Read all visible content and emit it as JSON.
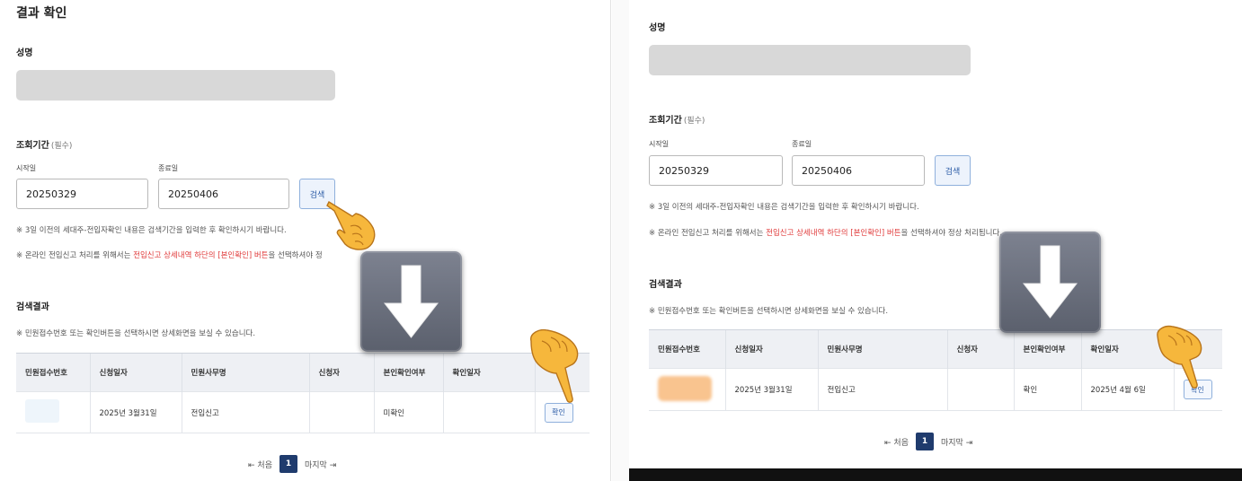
{
  "left": {
    "page_title": "결과 확인",
    "name_label": "성명",
    "period_label": "조회기간",
    "period_required": "(필수)",
    "start_label": "시작일",
    "end_label": "종료일",
    "start_value": "20250329",
    "end_value": "20250406",
    "search_label": "검색",
    "notice1": "※ 3일 이전의 세대주-전입자확인 내용은 검색기간을 입력한 후 확인하시기 바랍니다.",
    "notice2_pre": "※ 온라인 전입신고 처리를 위해서는 ",
    "notice2_hl": "전입신고 상세내역 하단의 [본인확인] 버튼",
    "notice2_post": "을 선택하셔야 정",
    "results_label": "검색결과",
    "results_notice": "※ 민원접수번호 또는 확인버튼을 선택하시면 상세화면을 보실 수 있습니다.",
    "table": {
      "headers": [
        "민원접수번호",
        "신청일자",
        "민원사무명",
        "신청자",
        "본인확인여부",
        "확인일자",
        ""
      ],
      "row": [
        "",
        "2025년 3월31일",
        "전입신고",
        "",
        "미확인",
        "",
        "확인"
      ]
    },
    "pager": {
      "first": "처음",
      "page": "1",
      "last": "마지막"
    }
  },
  "right": {
    "name_label": "성명",
    "period_label": "조회기간",
    "period_required": "(필수)",
    "start_label": "시작일",
    "end_label": "종료일",
    "start_value": "20250329",
    "end_value": "20250406",
    "search_label": "검색",
    "notice1": "※ 3일 이전의 세대주-전입자확인 내용은 검색기간을 입력한 후 확인하시기 바랍니다.",
    "notice2_pre": "※ 온라인 전입신고 처리를 위해서는 ",
    "notice2_hl": "전입신고 상세내역 하단의 [본인확인] 버튼",
    "notice2_post": "을 선택하셔야 정상 처리됩니다.",
    "results_label": "검색결과",
    "results_notice": "※ 민원접수번호 또는 확인버튼을 선택하시면 상세화면을 보실 수 있습니다.",
    "table": {
      "headers": [
        "민원접수번호",
        "신청일자",
        "민원사무명",
        "신청자",
        "본인확인여부",
        "확인일자",
        ""
      ],
      "row": [
        "",
        "2025년 3월31일",
        "전입신고",
        "",
        "확인",
        "2025년 4월 6일",
        "확인"
      ]
    },
    "pager": {
      "first": "처음",
      "page": "1",
      "last": "마지막"
    }
  },
  "icons": {
    "down_arrow": "down-arrow-icon",
    "pointing_hand": "pointing-hand-icon",
    "first_page": "first-page-icon",
    "last_page": "last-page-icon"
  },
  "colors": {
    "highlight_red": "#e03a3a",
    "button_blue": "#2b5ba6",
    "pager_active": "#1f3b6d",
    "redaction_orange": "#f9c48f"
  }
}
